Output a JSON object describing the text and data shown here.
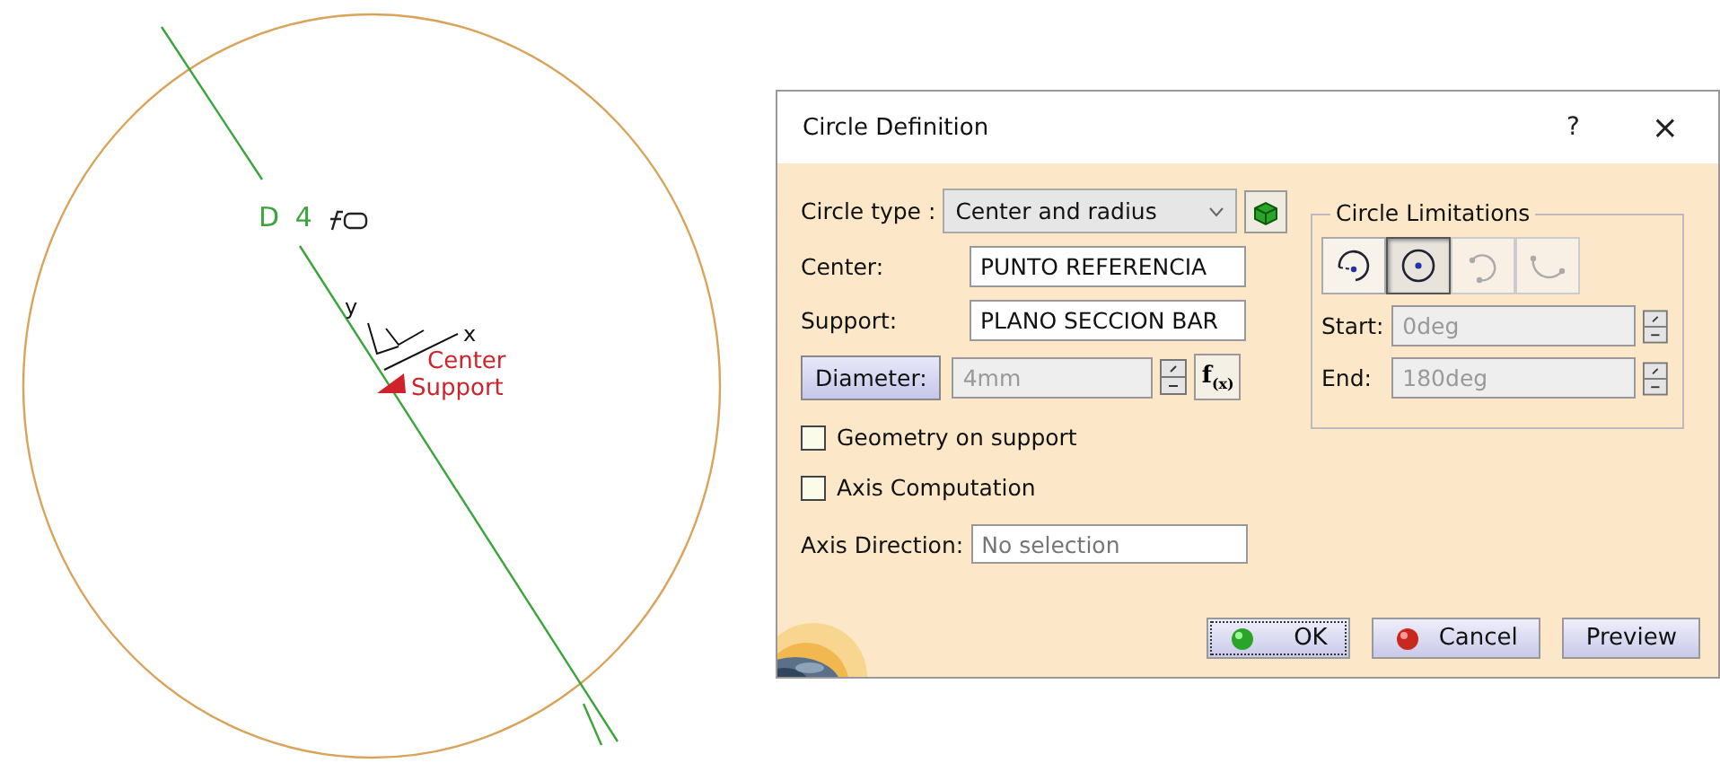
{
  "viewport": {
    "dimension_label": "D 4",
    "axis_labels": [
      "y",
      "x"
    ],
    "point_labels": [
      "Center",
      "Support"
    ]
  },
  "dialog": {
    "title": "Circle Definition",
    "help": "?",
    "close": "×",
    "circle_type": {
      "label": "Circle type :",
      "value": "Center and radius"
    },
    "fields": [
      {
        "label": "Center:",
        "value": "PUNTO REFERENCIA"
      },
      {
        "label": "Support:",
        "value": "PLANO SECCION BAR"
      }
    ],
    "diameter": {
      "label": "Diameter:",
      "value": "4mm",
      "disabled": true,
      "formula": "f$_{(x)}$"
    },
    "checkboxes": [
      {
        "label": "Geometry on support",
        "checked": false
      },
      {
        "label": "Axis Computation",
        "checked": false
      }
    ],
    "axis_direction": {
      "label": "Axis Direction:",
      "placeholder": "No selection"
    },
    "limitations": {
      "title": "Circle Limitations",
      "modes": [
        {
          "kind": "partial",
          "selected": false,
          "disabled": false
        },
        {
          "kind": "whole",
          "selected": true,
          "disabled": false
        },
        {
          "kind": "arc",
          "selected": false,
          "disabled": true
        },
        {
          "kind": "bow",
          "selected": false,
          "disabled": true
        }
      ],
      "start": {
        "label": "Start:",
        "value": "0deg",
        "disabled": true
      },
      "end": {
        "label": "End:",
        "value": "180deg",
        "disabled": true
      }
    },
    "buttons": [
      {
        "label": "OK",
        "kind": "ok"
      },
      {
        "label": "Cancel",
        "kind": "cancel"
      },
      {
        "label": "Preview",
        "kind": "plain"
      }
    ]
  }
}
